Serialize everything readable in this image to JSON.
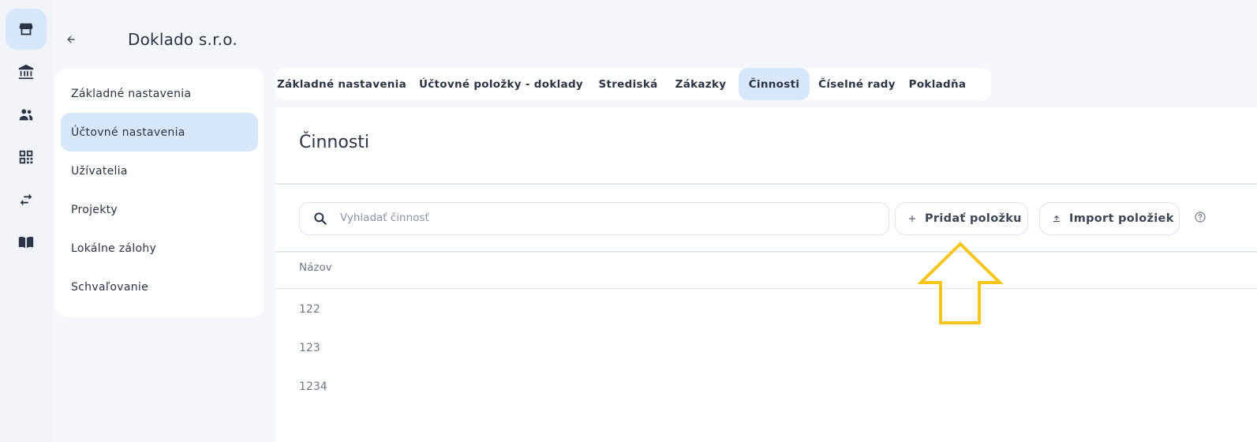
{
  "header": {
    "company_name": "Doklado s.r.o."
  },
  "rail": {
    "icons": [
      "store-icon",
      "bank-icon",
      "users-icon",
      "qr-code-icon",
      "transfer-icon",
      "book-icon"
    ]
  },
  "sidebar": {
    "items": [
      {
        "label": "Základné nastavenia"
      },
      {
        "label": "Účtovné nastavenia"
      },
      {
        "label": "Užívatelia"
      },
      {
        "label": "Projekty"
      },
      {
        "label": "Lokálne zálohy"
      },
      {
        "label": "Schvaľovanie"
      }
    ],
    "active_index": 1
  },
  "tabs": [
    {
      "label": "Základné nastavenia"
    },
    {
      "label": "Účtovné položky - doklady"
    },
    {
      "label": "Strediská"
    },
    {
      "label": "Zákazky"
    },
    {
      "label": "Činnosti"
    },
    {
      "label": "Číselné rady"
    },
    {
      "label": "Pokladňa"
    }
  ],
  "active_tab_index": 4,
  "main": {
    "title": "Činnosti",
    "search_placeholder": "Vyhladať činnosť",
    "add_button_label": "Pridať položku",
    "import_button_label": "Import položiek",
    "table": {
      "column_header": "Názov",
      "rows": [
        "122",
        "123",
        "1234"
      ]
    }
  },
  "colors": {
    "accent_bg": "#d9e7fb",
    "annotation_arrow": "#f5c518"
  }
}
